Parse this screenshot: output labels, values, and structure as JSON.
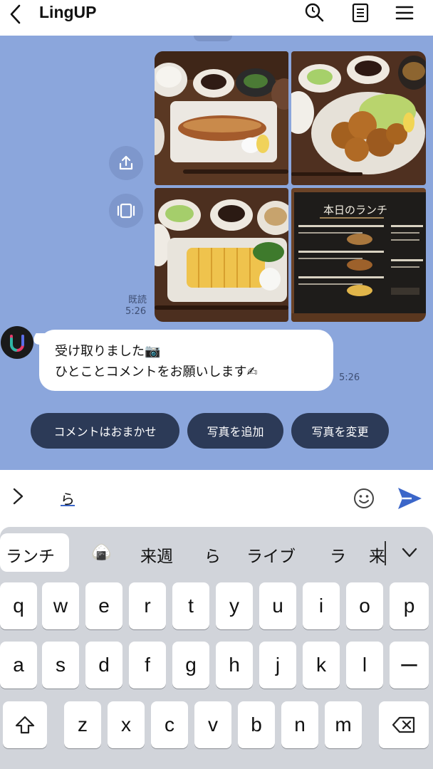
{
  "header": {
    "title": "LingUP",
    "icons": [
      "back-chevron-icon",
      "search-icon",
      "note-icon",
      "menu-icon"
    ]
  },
  "chat": {
    "background": "#8ba6dc",
    "photos": [
      {
        "name": "grilled-fish-set-photo"
      },
      {
        "name": "fried-chicken-set-photo"
      },
      {
        "name": "rolled-omelette-set-photo"
      },
      {
        "name": "menu-board-photo",
        "board_title": "本日のランチ"
      }
    ],
    "read_label": "既読",
    "read_time": "5:26",
    "message": {
      "line1": "受け取りました📷",
      "line2": "ひとことコメントをお願いします✍",
      "time": "5:26"
    },
    "quick_replies": [
      "コメントはおまかせ",
      "写真を追加",
      "写真を変更"
    ]
  },
  "input": {
    "value": "ら",
    "accent": "#3b66c9"
  },
  "keyboard": {
    "suggestions": [
      "ランチ",
      "🍙",
      "来週",
      "ら",
      "ライブ",
      "ラ",
      "来"
    ],
    "row1": [
      "q",
      "w",
      "e",
      "r",
      "t",
      "y",
      "u",
      "i",
      "o",
      "p"
    ],
    "row2": [
      "a",
      "s",
      "d",
      "f",
      "g",
      "h",
      "j",
      "k",
      "l",
      "ー"
    ],
    "row3": [
      "z",
      "x",
      "c",
      "v",
      "b",
      "n",
      "m"
    ]
  }
}
